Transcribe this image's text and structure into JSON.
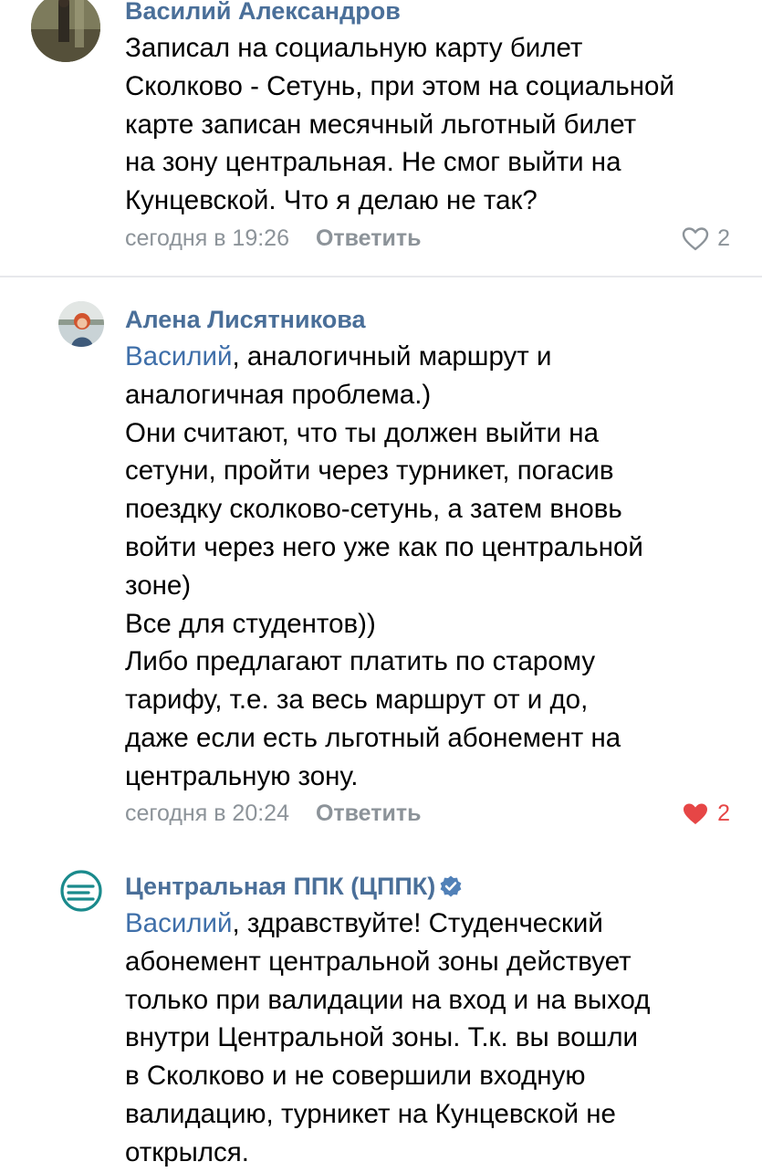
{
  "comments": [
    {
      "author": "Василий Александров",
      "lines": [
        "Записал на социальную карту билет",
        "Сколково - Сетунь, при этом на социальной",
        "карте записан месячный льготный билет",
        "на зону центральная. Не смог выйти на",
        "Кунцевской. Что я делаю не так?"
      ],
      "time": "сегодня в 19:26",
      "reply_label": "Ответить",
      "likes": "2",
      "liked": false
    },
    {
      "author": "Алена Лисятникова",
      "mention": "Василий",
      "first_line_rest": ", аналогичный маршрут и",
      "lines": [
        "аналогичная проблема.)",
        "Они считают,  что ты должен выйти на",
        "сетуни, пройти через турникет, погасив",
        "поездку сколково-сетунь, а затем вновь",
        "войти через него уже как по центральной",
        "зоне)",
        "Все для студентов))",
        "Либо предлагают платить по старому",
        "тарифу, т.е. за весь маршрут от и до,",
        "даже если есть льготный абонемент на",
        "центральную зону."
      ],
      "time": "сегодня в 20:24",
      "reply_label": "Ответить",
      "likes": "2",
      "liked": true
    },
    {
      "author": "Центральная ППК (ЦППК)",
      "verified": true,
      "mention": "Василий",
      "first_line_rest": ", здравствуйте! Студенческий",
      "lines": [
        "абонемент центральной зоны действует",
        "только при валидации на вход и на выход",
        "внутри Центральной зоны. Т.к. вы вошли",
        "в Сколково и не совершили входную",
        "валидацию, турникет на Кунцевской не",
        "открылся."
      ]
    }
  ],
  "colors": {
    "author": "#4a6f99",
    "mention": "#3f6fa9",
    "meta": "#8c9399",
    "liked_heart": "#e64646",
    "verified_badge": "#5181b8",
    "cppk_logo": "#1a8a8c"
  },
  "icons": {
    "like": "heart-outline-icon",
    "liked": "heart-filled-icon",
    "verified": "verified-check-icon"
  }
}
